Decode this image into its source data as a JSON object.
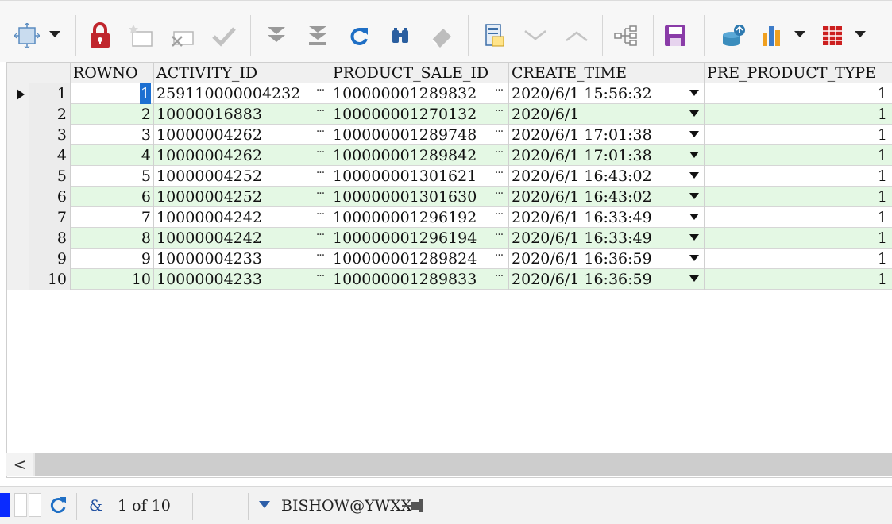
{
  "toolbar": {
    "items": [
      {
        "name": "select-mode-icon"
      },
      {
        "name": "lock-icon"
      },
      {
        "name": "insert-record-icon"
      },
      {
        "name": "delete-record-icon"
      },
      {
        "name": "post-changes-icon"
      },
      {
        "name": "fetch-next-icon"
      },
      {
        "name": "fetch-last-icon"
      },
      {
        "name": "refresh-icon"
      },
      {
        "name": "query-by-example-icon"
      },
      {
        "name": "clear-icon"
      },
      {
        "name": "single-record-view-icon"
      },
      {
        "name": "next-record-icon"
      },
      {
        "name": "previous-record-icon"
      },
      {
        "name": "tree-view-icon"
      },
      {
        "name": "save-icon"
      },
      {
        "name": "export-icon"
      },
      {
        "name": "chart-icon"
      },
      {
        "name": "table-view-icon"
      }
    ],
    "colors": {
      "lock": "#c0262d",
      "refresh": "#1f6fc5",
      "save": "#8a3ca8",
      "chart_bars": [
        "#f0a020",
        "#3d7cc9",
        "#f0a020"
      ],
      "table": "#cc1f1f"
    }
  },
  "grid": {
    "columns": [
      "ROWNO",
      "ACTIVITY_ID",
      "PRODUCT_SALE_ID",
      "CREATE_TIME",
      "PRE_PRODUCT_TYPE"
    ],
    "rows": [
      {
        "n": "1",
        "rowno": "1",
        "activity_id": "259110000004232",
        "product_sale_id": "100000001289832",
        "create_time": "2020/6/1 15:56:32",
        "pre_product_type": "1"
      },
      {
        "n": "2",
        "rowno": "2",
        "activity_id": "10000016883",
        "product_sale_id": "100000001270132",
        "create_time": "2020/6/1",
        "pre_product_type": "1"
      },
      {
        "n": "3",
        "rowno": "3",
        "activity_id": "10000004262",
        "product_sale_id": "100000001289748",
        "create_time": "2020/6/1 17:01:38",
        "pre_product_type": "1"
      },
      {
        "n": "4",
        "rowno": "4",
        "activity_id": "10000004262",
        "product_sale_id": "100000001289842",
        "create_time": "2020/6/1 17:01:38",
        "pre_product_type": "1"
      },
      {
        "n": "5",
        "rowno": "5",
        "activity_id": "10000004252",
        "product_sale_id": "100000001301621",
        "create_time": "2020/6/1 16:43:02",
        "pre_product_type": "1"
      },
      {
        "n": "6",
        "rowno": "6",
        "activity_id": "10000004252",
        "product_sale_id": "100000001301630",
        "create_time": "2020/6/1 16:43:02",
        "pre_product_type": "1"
      },
      {
        "n": "7",
        "rowno": "7",
        "activity_id": "10000004242",
        "product_sale_id": "100000001296192",
        "create_time": "2020/6/1 16:33:49",
        "pre_product_type": "1"
      },
      {
        "n": "8",
        "rowno": "8",
        "activity_id": "10000004242",
        "product_sale_id": "100000001296194",
        "create_time": "2020/6/1 16:33:49",
        "pre_product_type": "1"
      },
      {
        "n": "9",
        "rowno": "9",
        "activity_id": "10000004233",
        "product_sale_id": "100000001289824",
        "create_time": "2020/6/1 16:36:59",
        "pre_product_type": "1"
      },
      {
        "n": "10",
        "rowno": "10",
        "activity_id": "10000004233",
        "product_sale_id": "100000001289833",
        "create_time": "2020/6/1 16:36:59",
        "pre_product_type": "1"
      }
    ],
    "ellipsis": "···",
    "alt_row_color": "#e4f8e4"
  },
  "scrollbar": {
    "left_arrow": "<"
  },
  "status": {
    "ampersand": "&",
    "record_info": "1 of 10",
    "connection": "BISHOW@YWXX"
  }
}
